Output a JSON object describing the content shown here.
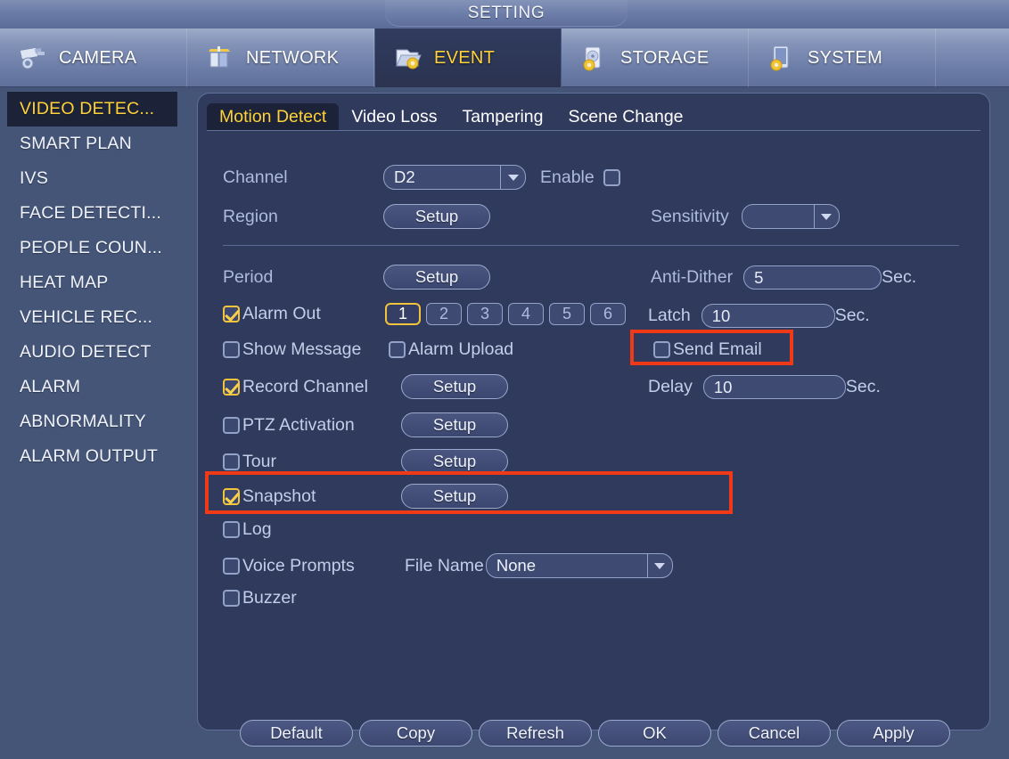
{
  "window": {
    "title": "SETTING"
  },
  "nav": {
    "items": [
      {
        "label": "CAMERA",
        "icon": "camera-icon",
        "active": false
      },
      {
        "label": "NETWORK",
        "icon": "network-icon",
        "active": false
      },
      {
        "label": "EVENT",
        "icon": "event-icon",
        "active": true
      },
      {
        "label": "STORAGE",
        "icon": "storage-icon",
        "active": false
      },
      {
        "label": "SYSTEM",
        "icon": "system-icon",
        "active": false
      }
    ]
  },
  "sidebar": {
    "items": [
      {
        "label": "VIDEO DETEC...",
        "active": true
      },
      {
        "label": "SMART PLAN",
        "active": false
      },
      {
        "label": "IVS",
        "active": false
      },
      {
        "label": "FACE DETECTI...",
        "active": false
      },
      {
        "label": "PEOPLE COUN...",
        "active": false
      },
      {
        "label": "HEAT MAP",
        "active": false
      },
      {
        "label": "VEHICLE REC...",
        "active": false
      },
      {
        "label": "AUDIO DETECT",
        "active": false
      },
      {
        "label": "ALARM",
        "active": false
      },
      {
        "label": "ABNORMALITY",
        "active": false
      },
      {
        "label": "ALARM OUTPUT",
        "active": false
      }
    ]
  },
  "tabs": [
    {
      "label": "Motion Detect",
      "active": true
    },
    {
      "label": "Video Loss",
      "active": false
    },
    {
      "label": "Tampering",
      "active": false
    },
    {
      "label": "Scene Change",
      "active": false
    }
  ],
  "form": {
    "channel_label": "Channel",
    "channel_value": "D2",
    "enable_label": "Enable",
    "enable_checked": false,
    "region_label": "Region",
    "region_button": "Setup",
    "sensitivity_label": "Sensitivity",
    "sensitivity_value": "",
    "period_label": "Period",
    "period_button": "Setup",
    "antidither_label": "Anti-Dither",
    "antidither_value": "5",
    "antidither_unit": "Sec.",
    "alarm_out_label": "Alarm Out",
    "alarm_out_checked": true,
    "alarm_out_buttons": [
      "1",
      "2",
      "3",
      "4",
      "5",
      "6"
    ],
    "alarm_out_selected": "1",
    "latch_label": "Latch",
    "latch_value": "10",
    "latch_unit": "Sec.",
    "show_message_label": "Show Message",
    "show_message_checked": false,
    "alarm_upload_label": "Alarm Upload",
    "alarm_upload_checked": false,
    "send_email_label": "Send Email",
    "send_email_checked": false,
    "record_channel_label": "Record Channel",
    "record_channel_checked": true,
    "record_channel_button": "Setup",
    "delay_label": "Delay",
    "delay_value": "10",
    "delay_unit": "Sec.",
    "ptz_label": "PTZ Activation",
    "ptz_checked": false,
    "ptz_button": "Setup",
    "tour_label": "Tour",
    "tour_checked": false,
    "tour_button": "Setup",
    "snapshot_label": "Snapshot",
    "snapshot_checked": true,
    "snapshot_button": "Setup",
    "log_label": "Log",
    "log_checked": false,
    "voice_prompts_label": "Voice Prompts",
    "voice_prompts_checked": false,
    "file_name_label": "File Name",
    "file_name_value": "None",
    "buzzer_label": "Buzzer",
    "buzzer_checked": false
  },
  "footer": {
    "buttons": [
      "Default",
      "Copy",
      "Refresh",
      "OK",
      "Cancel",
      "Apply"
    ]
  },
  "highlights": {
    "send_email": "red-highlight-box",
    "snapshot": "red-highlight-box"
  },
  "colors": {
    "accent_yellow": "#ffd23a",
    "highlight_red": "#f03a17",
    "panel_bg": "#303a5c",
    "outer_bg": "#455578"
  }
}
